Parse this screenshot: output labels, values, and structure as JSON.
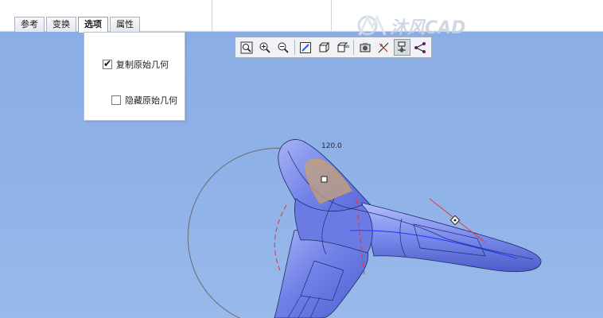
{
  "tabs": [
    {
      "label": "参考",
      "active": false
    },
    {
      "label": "变换",
      "active": false
    },
    {
      "label": "选项",
      "active": true
    },
    {
      "label": "属性",
      "active": false
    }
  ],
  "options": {
    "copy_original": {
      "label": "复制原始几何",
      "checked": true
    },
    "hide_original": {
      "label": "隐藏原始几何",
      "checked": false
    }
  },
  "toolbar": {
    "icons": [
      "zoom-fit-icon",
      "zoom-in-icon",
      "zoom-out-icon",
      "repaint-icon",
      "orientation-icon",
      "saved-views-icon",
      "display-style-icon",
      "datum-display-icon",
      "spin-center-icon",
      "annotation-display-icon"
    ]
  },
  "watermark": {
    "text": "沐风CAD"
  },
  "dimension": {
    "value": "120.0"
  },
  "colors": {
    "viewport_bg": "#8db0e6",
    "model_fill": "#6f7fe6",
    "model_highlight": "#b9c3f5",
    "selection_orange": "#e09a3a",
    "dashed_red": "#e03a3a"
  }
}
